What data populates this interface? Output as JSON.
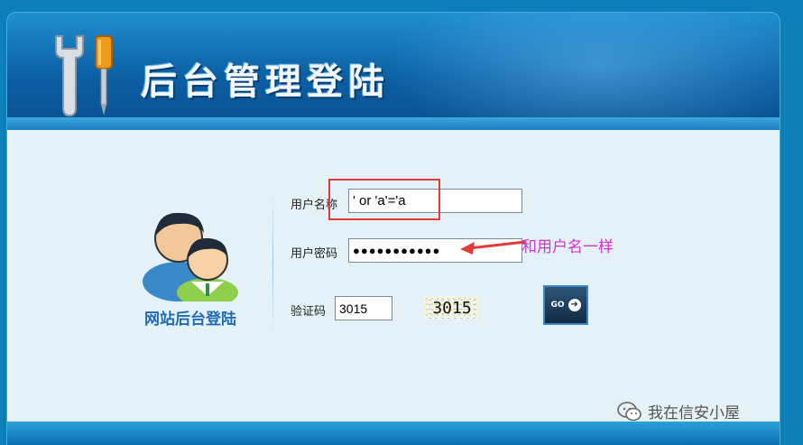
{
  "header": {
    "title": "后台管理登陆"
  },
  "sidebar": {
    "site_title": "网站后台登陆"
  },
  "form": {
    "username_label": "用户名称",
    "username_value": "' or 'a'='a",
    "password_label": "用户密码",
    "password_value": "●●●●●●●●●●●",
    "captcha_label": "验证码",
    "captcha_value": "3015",
    "captcha_image_text": "3015",
    "go_button_label": "GO"
  },
  "annotation": {
    "text": "和用户名一样"
  },
  "watermark": {
    "text": "我在信安小屋"
  },
  "colors": {
    "header": "#0b5fa3",
    "annotation_text": "#d62fd6",
    "highlight_box": "#e23a3a",
    "arrow": "#e23a3a",
    "site_title": "#1f6bb6"
  },
  "icons": {
    "header_icon": "wrench-screwdriver-icon",
    "avatar_icon": "admin-users-icon",
    "go_icon": "go-arrow-icon",
    "watermark_icon": "wechat-icon"
  }
}
